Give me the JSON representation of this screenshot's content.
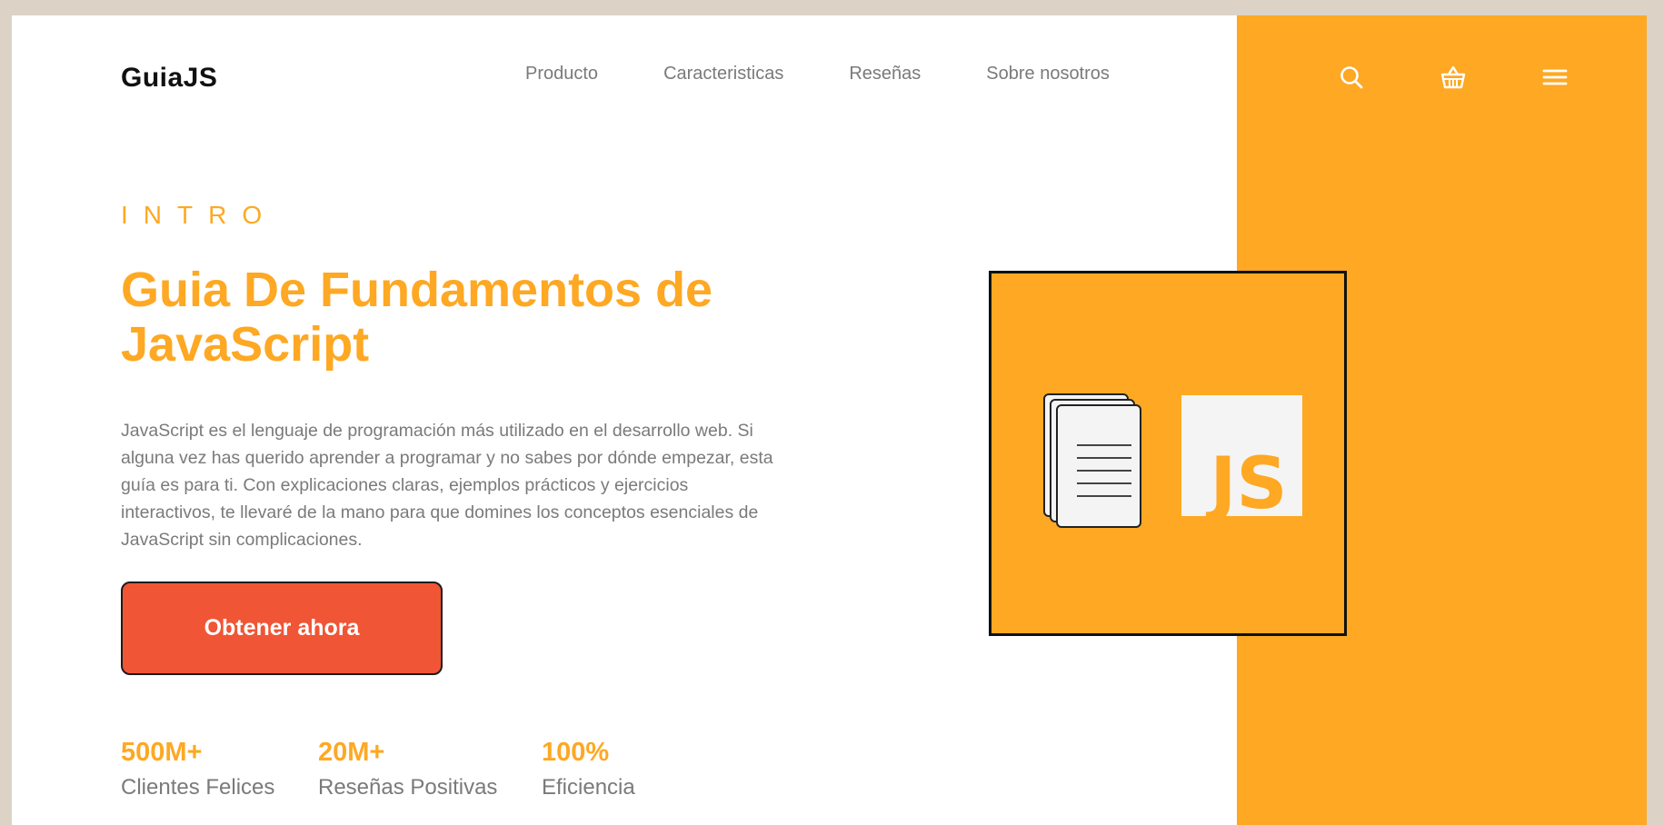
{
  "colors": {
    "accent": "#fea823",
    "button": "#f05535",
    "text_muted": "#7a7a7a",
    "background": "#dcd3c6"
  },
  "header": {
    "logo": "GuiaJS",
    "nav": [
      {
        "label": "Producto"
      },
      {
        "label": "Caracteristicas"
      },
      {
        "label": "Reseñas"
      },
      {
        "label": "Sobre nosotros"
      }
    ],
    "icons": [
      "search-icon",
      "basket-icon",
      "menu-icon"
    ]
  },
  "hero": {
    "eyebrow": "INTRO",
    "title_line1": "Guia De Fundamentos de",
    "title_line2": "JavaScript",
    "description": "JavaScript es el lenguaje de programación más utilizado en el desarrollo web. Si alguna vez has querido aprender a programar y no sabes por dónde empezar, esta guía es para ti. Con explicaciones claras, ejemplos prácticos y ejercicios interactivos, te llevaré de la mano para que domines los conceptos esenciales de JavaScript sin complicaciones.",
    "cta_label": "Obtener ahora"
  },
  "stats": [
    {
      "value": "500M+",
      "label": "Clientes Felices"
    },
    {
      "value": "20M+",
      "label": "Reseñas Positivas"
    },
    {
      "value": "100%",
      "label": "Eficiencia"
    }
  ],
  "illustration": {
    "js_badge": "JS"
  }
}
